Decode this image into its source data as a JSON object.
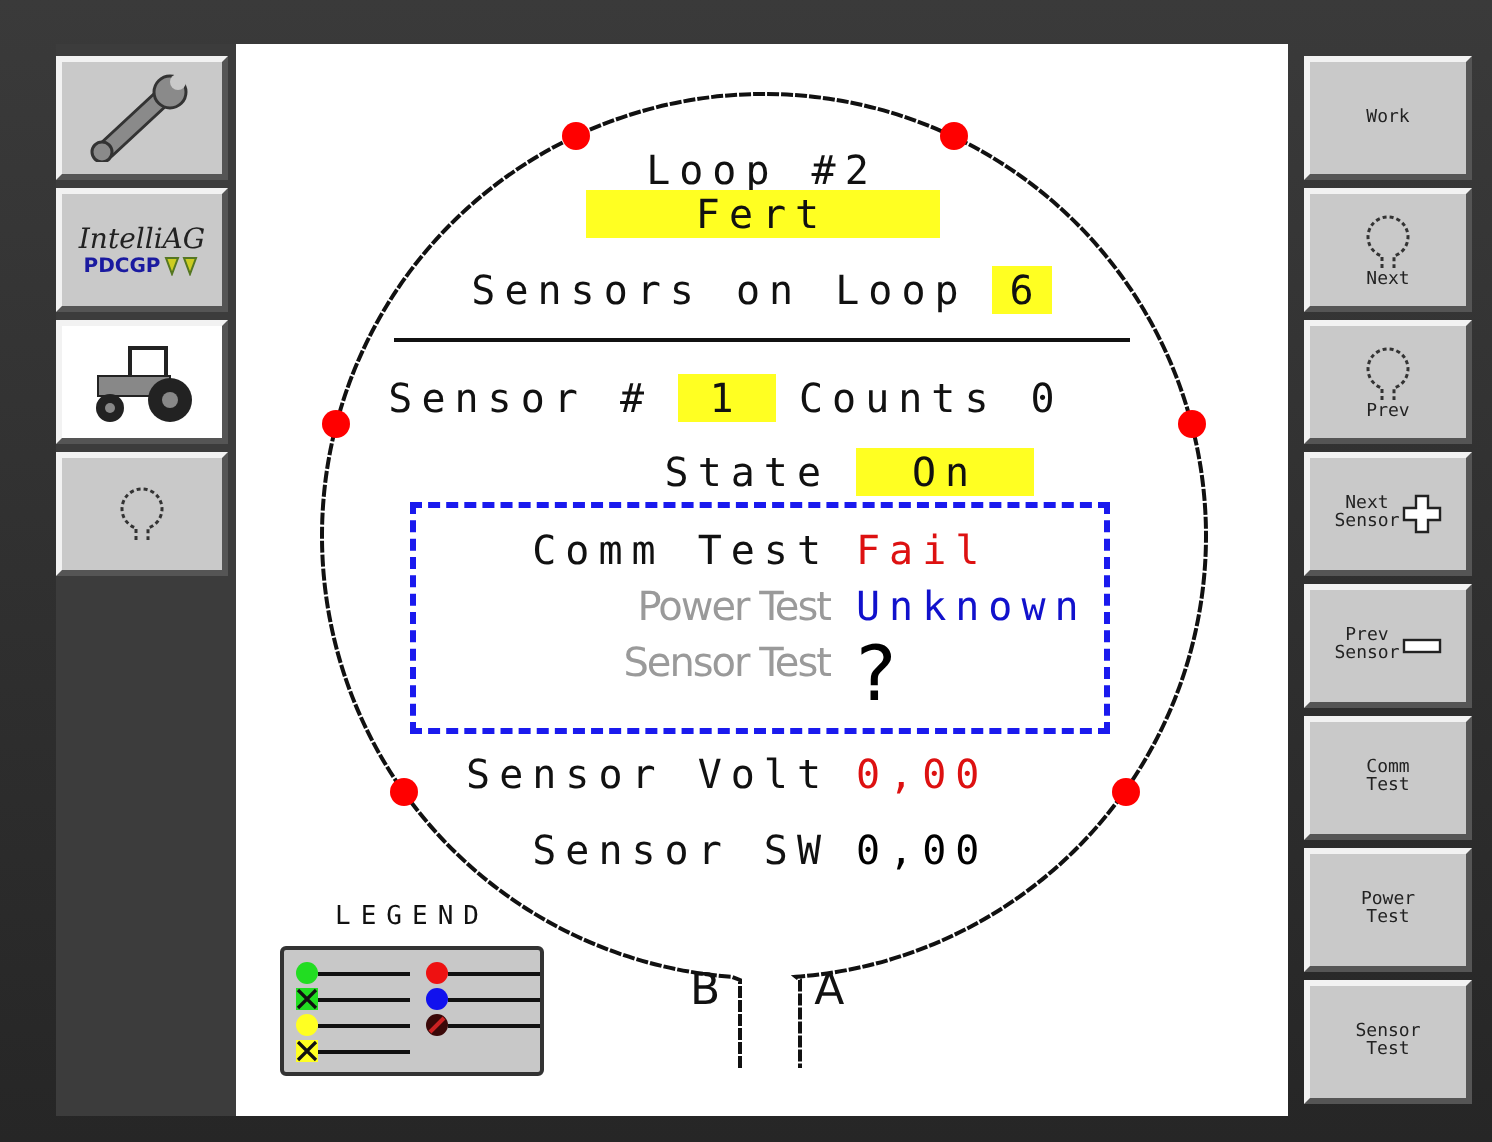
{
  "left_toolbar": [
    {
      "kind": "wrench",
      "selected": false
    },
    {
      "kind": "logo",
      "selected": false,
      "brand": "IntelliAG",
      "product": "PDCGP"
    },
    {
      "kind": "tractor",
      "selected": true
    },
    {
      "kind": "loop",
      "selected": false
    }
  ],
  "loop": {
    "title": "Loop #2",
    "product": "Fert",
    "sensors_label": "Sensors on Loop",
    "sensors_count": "6",
    "sensor_label": "Sensor #",
    "sensor_number": "1",
    "counts": "Counts 0",
    "state_label": "State",
    "state": "On",
    "sensors": [
      {
        "color": "#ff0000"
      },
      {
        "color": "#ff0000"
      },
      {
        "color": "#ff0000"
      },
      {
        "color": "#ff0000"
      },
      {
        "color": "#ff0000"
      },
      {
        "color": "#ff0000"
      }
    ],
    "tests": [
      {
        "label": "Comm Test",
        "enabled": true,
        "kind": "text",
        "result": "Fail",
        "color": "#dd1111"
      },
      {
        "label": "Power Test",
        "enabled": false,
        "kind": "text",
        "result": "Unknown",
        "color": "#1111cc"
      },
      {
        "label": "Sensor Test",
        "enabled": false,
        "kind": "symbol",
        "result": "?",
        "color": "#000000"
      }
    ],
    "readings": [
      {
        "label": "Sensor Volt",
        "value": "0,00",
        "color": "#dd1111"
      },
      {
        "label": "Sensor SW",
        "value": "0,00",
        "color": "#000000"
      }
    ],
    "ports": [
      "B",
      "A"
    ]
  },
  "legend": {
    "title": "LEGEND",
    "items": [
      {
        "kind": "dot",
        "color": "#22dd22"
      },
      {
        "kind": "crossed",
        "color": "#22dd22"
      },
      {
        "kind": "dot",
        "color": "#ffff22"
      },
      {
        "kind": "crossed",
        "color": "#ffff22"
      },
      {
        "kind": "dot",
        "color": "#ee1111"
      },
      {
        "kind": "dot",
        "color": "#1111ee"
      },
      {
        "kind": "slashed",
        "color": "#3a0808"
      }
    ]
  },
  "right_toolbar": [
    {
      "kind": "text",
      "lines": [
        "Work"
      ]
    },
    {
      "kind": "loop",
      "lines": [
        "Next"
      ]
    },
    {
      "kind": "loop",
      "lines": [
        "Prev"
      ]
    },
    {
      "kind": "plus",
      "lines": [
        "Next",
        "Sensor"
      ]
    },
    {
      "kind": "minus",
      "lines": [
        "Prev",
        "Sensor"
      ]
    },
    {
      "kind": "text",
      "lines": [
        "Comm",
        "Test"
      ]
    },
    {
      "kind": "text",
      "lines": [
        "Power",
        "Test"
      ]
    },
    {
      "kind": "text",
      "lines": [
        "Sensor",
        "Test"
      ]
    }
  ]
}
